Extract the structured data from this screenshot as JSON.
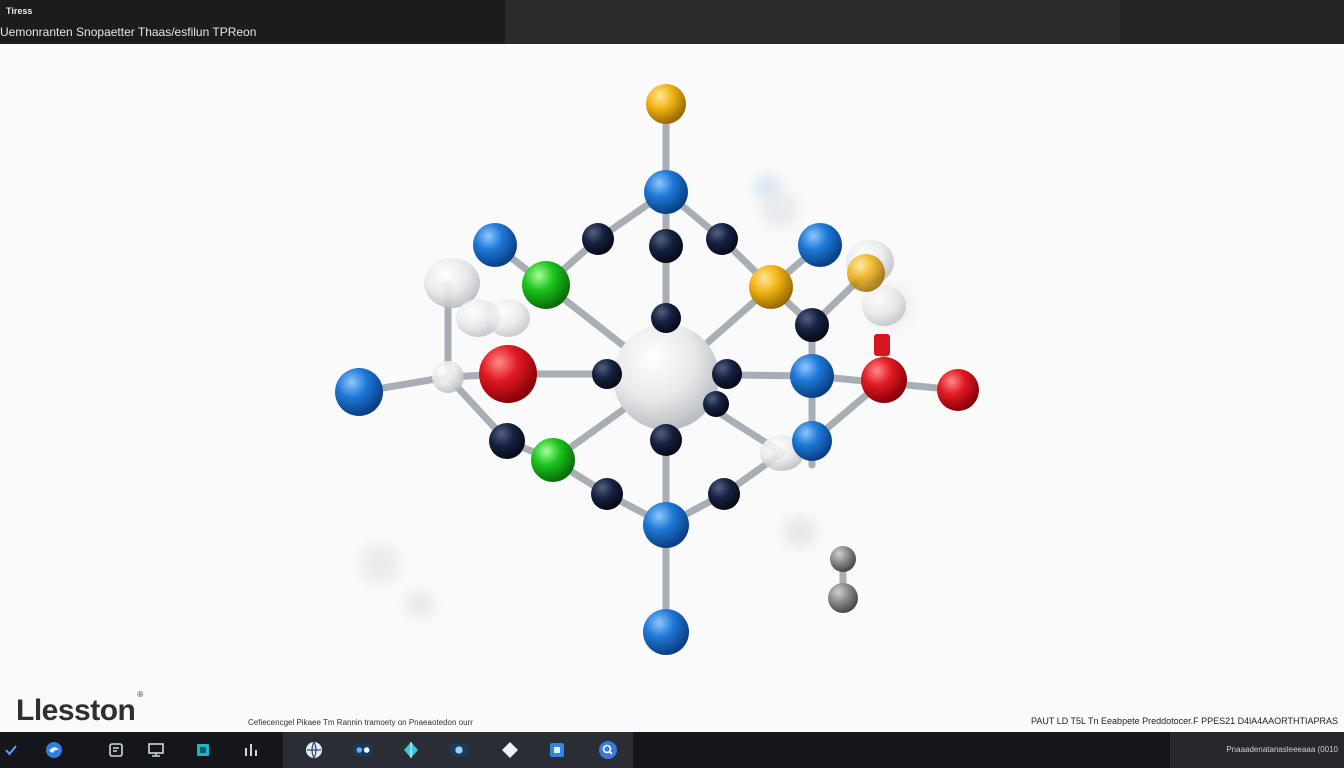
{
  "window": {
    "app_name": "Tiress",
    "title": "Uemonranten Snopaetter Thaas/esfilun TPReon"
  },
  "branding": {
    "logo_text": "Llesston",
    "logo_mark": "®"
  },
  "footer": {
    "caption": "Cefiecencgel Pikaee Tm Rannin tramoety on Pnaeaotedon ourr",
    "status_right": "PAUT LD T5L Tn Eeabpete Preddotocer.F PPES21 D4lA4AAORTHTIAPRAS"
  },
  "taskbar": {
    "tray_text": "Pnaaadenatanasleeeaaa (0010"
  },
  "colors": {
    "titlebar": "#1c1c1e",
    "canvas": "#fafafa",
    "taskbar": "#14161b",
    "atom_blue": "#1e78d6",
    "atom_navy": "#152040",
    "atom_red": "#e01a22",
    "atom_green": "#1cc41c",
    "atom_yellow": "#f1b415",
    "atom_white": "#f1f1f1",
    "atom_gray": "#8a8a8a",
    "bond": "#a9aeb5"
  },
  "icons": [
    "check-icon",
    "edge-browser-icon",
    "file-icon",
    "monitor-icon",
    "cube-icon",
    "chart-bars-icon",
    "globe-icon",
    "molecule-app-icon",
    "gem-icon",
    "window-app-icon",
    "diamond-icon",
    "store-icon",
    "search-icon"
  ]
}
